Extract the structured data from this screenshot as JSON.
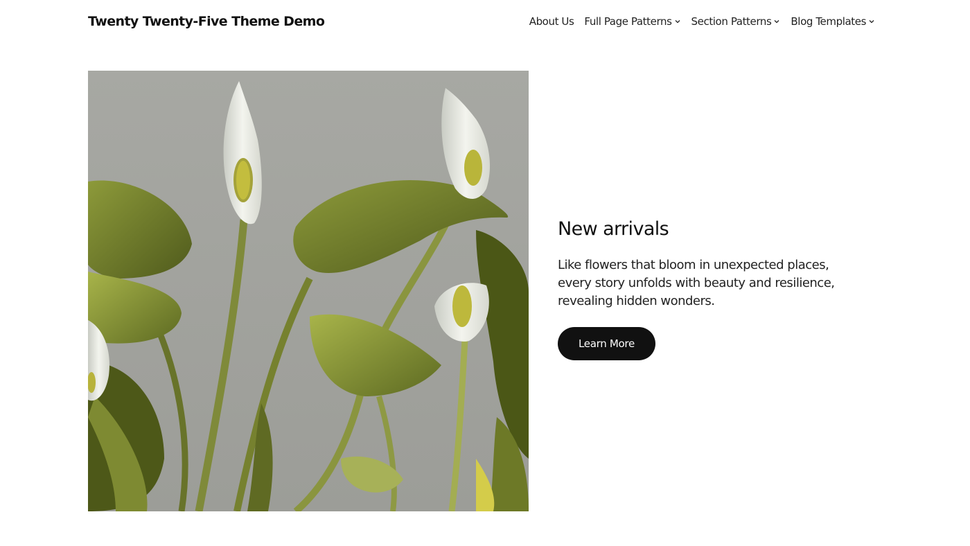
{
  "header": {
    "site_title": "Twenty Twenty-Five Theme Demo",
    "nav": [
      {
        "label": "About Us",
        "has_submenu": false
      },
      {
        "label": "Full Page Patterns",
        "has_submenu": true
      },
      {
        "label": "Section Patterns",
        "has_submenu": true
      },
      {
        "label": "Blog Templates",
        "has_submenu": true
      }
    ]
  },
  "hero": {
    "image": "calla-lily-botanical-illustration",
    "heading": "New arrivals",
    "description": "Like flowers that bloom in unexpected places, every story unfolds with beauty and resilience, revealing hidden wonders.",
    "button_label": "Learn More"
  },
  "colors": {
    "background": "#ffffff",
    "text": "#111111",
    "button_bg": "#111111",
    "button_text": "#ffffff",
    "image_backdrop": "#a9aaa5",
    "leaf_green": "#6f7a2a"
  }
}
